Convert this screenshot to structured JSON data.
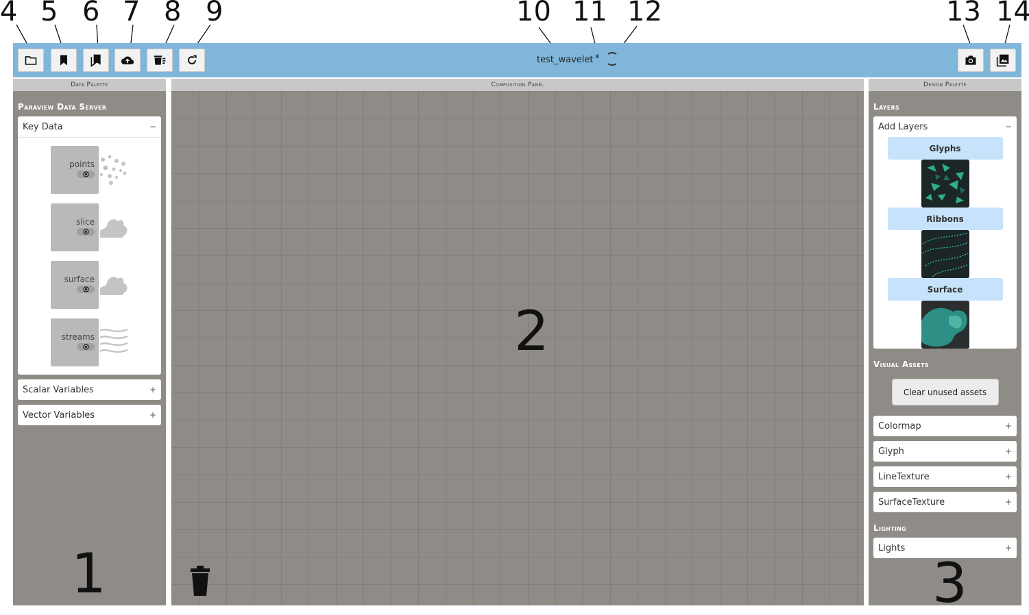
{
  "callouts": [
    "4",
    "5",
    "6",
    "7",
    "8",
    "9",
    "10",
    "11",
    "12",
    "13",
    "14"
  ],
  "region_labels": {
    "data_palette": "1",
    "composition_panel": "2",
    "design_palette": "3"
  },
  "toolbar": {
    "doc_title": "test_wavelet",
    "dirty_marker": "*",
    "buttons": [
      {
        "icon": "folder-icon"
      },
      {
        "icon": "bookmark-icon"
      },
      {
        "icon": "bookmarks-icon"
      },
      {
        "icon": "cloud-upload-icon"
      },
      {
        "icon": "delete-list-icon"
      },
      {
        "icon": "refresh-icon"
      },
      {
        "icon": "camera-icon"
      },
      {
        "icon": "image-icon"
      }
    ],
    "color": "#7fb6d9"
  },
  "data_palette": {
    "header": "Data Palette",
    "section": "Paraview Data Server",
    "key_data": {
      "label": "Key Data",
      "sign": "−",
      "items": [
        {
          "label": "points",
          "icon": "points-icon"
        },
        {
          "label": "slice",
          "icon": "slice-icon"
        },
        {
          "label": "surface",
          "icon": "surface-icon"
        },
        {
          "label": "streams",
          "icon": "streams-icon"
        }
      ]
    },
    "scalar_variables": {
      "label": "Scalar Variables",
      "sign": "+"
    },
    "vector_variables": {
      "label": "Vector Variables",
      "sign": "+"
    }
  },
  "composition_panel": {
    "header": "Composition Panel"
  },
  "design_palette": {
    "header": "Design Palette",
    "layers_section": "Layers",
    "add_layers": {
      "label": "Add Layers",
      "sign": "−",
      "items": [
        {
          "label": "Glyphs"
        },
        {
          "label": "Ribbons"
        },
        {
          "label": "Surface"
        }
      ]
    },
    "visual_assets_section": "Visual Assets",
    "clear_button": "Clear unused assets",
    "assets": [
      {
        "label": "Colormap",
        "sign": "+"
      },
      {
        "label": "Glyph",
        "sign": "+"
      },
      {
        "label": "LineTexture",
        "sign": "+"
      },
      {
        "label": "SurfaceTexture",
        "sign": "+"
      }
    ],
    "lighting_section": "Lighting",
    "lights": {
      "label": "Lights",
      "sign": "+"
    }
  }
}
